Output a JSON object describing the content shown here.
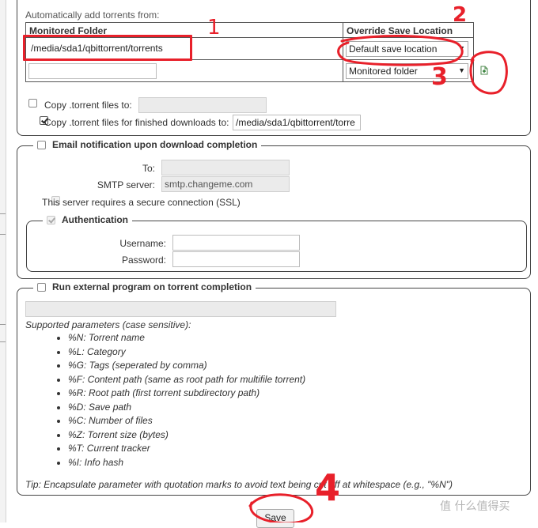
{
  "auto_add": {
    "label": "Automatically add torrents from:",
    "col_monitored": "Monitored Folder",
    "col_override": "Override Save Location",
    "rows": [
      {
        "folder": "/media/sda1/qbittorrent/torrents",
        "location": "Default save location"
      },
      {
        "folder": "",
        "location": "Monitored folder"
      }
    ],
    "copy_label": "Copy .torrent files to:",
    "copy_checked": false,
    "copy_value": "",
    "copy_finished_label": "Copy .torrent files for finished downloads to:",
    "copy_finished_checked": true,
    "copy_finished_value": "/media/sda1/qbittorrent/torre"
  },
  "email": {
    "legend": "Email notification upon download completion",
    "checked": false,
    "to_label": "To:",
    "to_value": "",
    "smtp_label": "SMTP server:",
    "smtp_value": "smtp.changeme.com",
    "ssl_label": "This server requires a secure connection (SSL)",
    "auth_legend": "Authentication",
    "auth_checked": true,
    "username_label": "Username:",
    "username_value": "",
    "password_label": "Password:",
    "password_value": ""
  },
  "external": {
    "legend": "Run external program on torrent completion",
    "checked": false,
    "command_value": "",
    "supported_label": "Supported parameters (case sensitive):",
    "params": [
      "%N: Torrent name",
      "%L: Category",
      "%G: Tags (seperated by comma)",
      "%F: Content path (same as root path for multifile torrent)",
      "%R: Root path (first torrent subdirectory path)",
      "%D: Save path",
      "%C: Number of files",
      "%Z: Torrent size (bytes)",
      "%T: Current tracker",
      "%I: Info hash"
    ],
    "tip": "Tip: Encapsulate parameter with quotation marks to avoid text being cut off at whitespace (e.g., \"%N\")"
  },
  "save_button": "Save",
  "annotations": [
    "1",
    "2",
    "3",
    "4"
  ],
  "watermark": "值 什么值得买",
  "icons": {
    "add_row": "add-file-icon",
    "dropdown": "chevron-down-icon"
  },
  "colors": {
    "annotation": "#e8202a",
    "border": "#444444",
    "disabled_bg": "#ebebeb"
  }
}
